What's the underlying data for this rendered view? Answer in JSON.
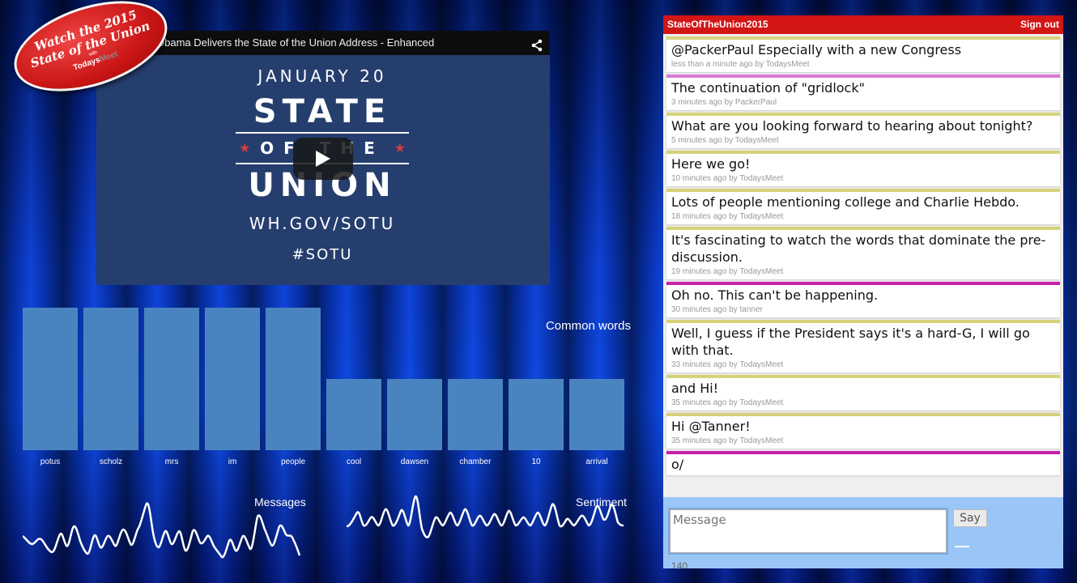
{
  "badge": {
    "line1": "Watch the 2015",
    "line2": "State of the Union",
    "with": "with",
    "brand_a": "Todays",
    "brand_b": "Meet"
  },
  "video": {
    "title": "Obama Delivers the State of the Union Address - Enhanced",
    "share_icon": "share-icon",
    "play_icon": "play-icon",
    "poster": {
      "date": "JANUARY 20",
      "state": "STATE",
      "of_the": "OF THE",
      "union": "UNION",
      "site": "WH.GOV/SOTU",
      "hashtag": "#SOTU"
    }
  },
  "common_words": {
    "title": "Common words",
    "color": "#4a84c0",
    "chart_data": {
      "type": "bar",
      "categories": [
        "potus",
        "scholz",
        "mrs",
        "im",
        "people",
        "cool",
        "dawsen",
        "chamber",
        "10",
        "arrival"
      ],
      "values": [
        2,
        2,
        2,
        2,
        2,
        1,
        1,
        1,
        1,
        1
      ],
      "ylim": [
        0,
        2
      ]
    }
  },
  "messages_wave": {
    "title": "Messages"
  },
  "sentiment_wave": {
    "title": "Sentiment"
  },
  "chat": {
    "room": "StateOfTheUnion2015",
    "signout": "Sign out",
    "messages": [
      {
        "text": "@PackerPaul Especially with a new Congress",
        "meta": "less than a minute ago by TodaysMeet",
        "color": "yellow"
      },
      {
        "text": "The continuation of \"gridlock\"",
        "meta": "3 minutes ago by PackerPaul",
        "color": "pink"
      },
      {
        "text": "What are you looking forward to hearing about tonight?",
        "meta": "5 minutes ago by TodaysMeet",
        "color": "yellow"
      },
      {
        "text": "Here we go!",
        "meta": "10 minutes ago by TodaysMeet",
        "color": "yellow"
      },
      {
        "text": "Lots of people mentioning college and Charlie Hebdo.",
        "meta": "18 minutes ago by TodaysMeet",
        "color": "yellow"
      },
      {
        "text": "It's fascinating to watch the words that dominate the pre-discussion.",
        "meta": "19 minutes ago by TodaysMeet",
        "color": "yellow"
      },
      {
        "text": "Oh no. This can't be happening.",
        "meta": "30 minutes ago by tanner",
        "color": "magenta"
      },
      {
        "text": "Well, I guess if the President says it's a hard-G, I will go with that.",
        "meta": "33 minutes ago by TodaysMeet",
        "color": "yellow"
      },
      {
        "text": "and Hi!",
        "meta": "35 minutes ago by TodaysMeet",
        "color": "yellow"
      },
      {
        "text": "Hi @Tanner!",
        "meta": "35 minutes ago by TodaysMeet",
        "color": "yellow"
      },
      {
        "text": "o/",
        "meta": "",
        "color": "magenta"
      }
    ],
    "compose": {
      "placeholder": "Message",
      "say_label": "Say",
      "counter": "140"
    }
  }
}
